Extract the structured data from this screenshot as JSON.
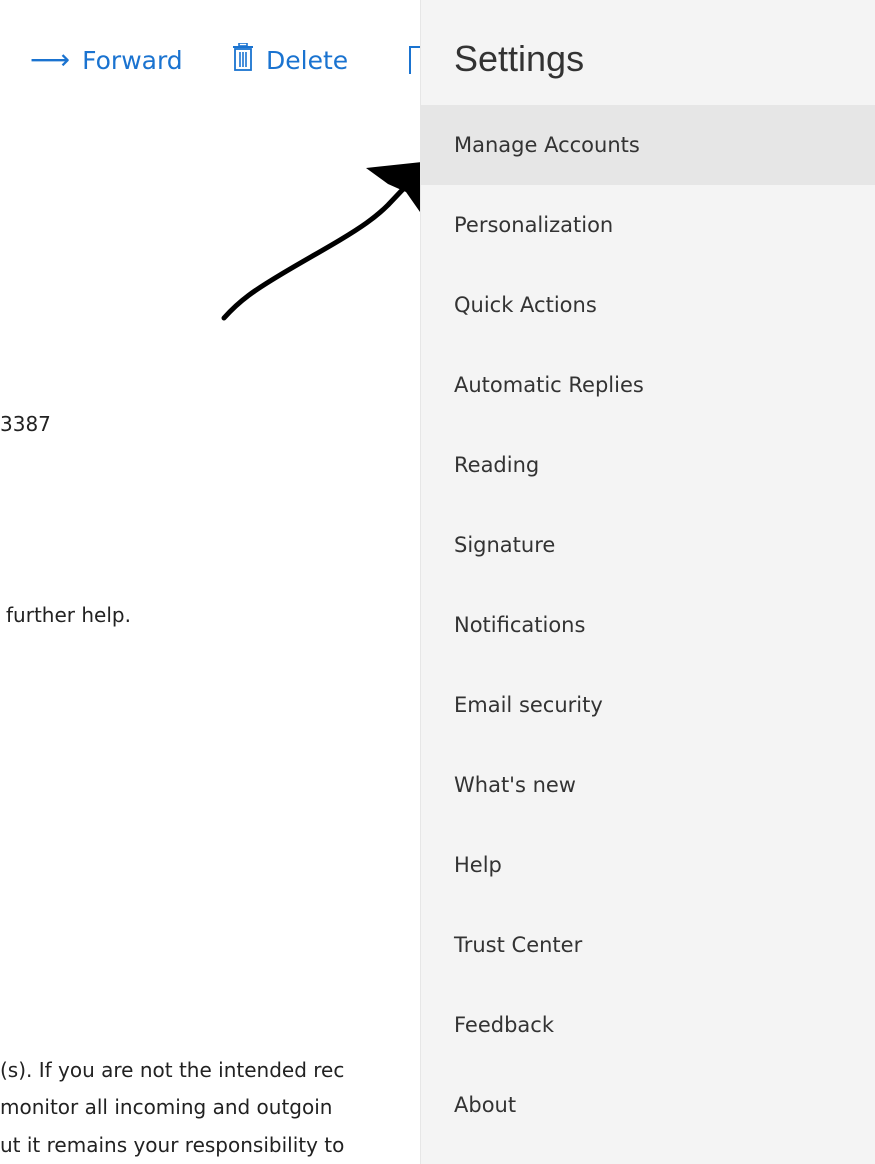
{
  "toolbar": {
    "forward_label": "Forward",
    "delete_label": "Delete"
  },
  "email_body": {
    "line_number": "3387",
    "line_help": "further help.",
    "disclaimer_1": "(s). If you are not the intended rec",
    "disclaimer_2": "monitor all incoming and outgoin",
    "disclaimer_3": "ut it remains your responsibility to"
  },
  "settings": {
    "title": "Settings",
    "items": [
      {
        "label": "Manage Accounts",
        "selected": true
      },
      {
        "label": "Personalization"
      },
      {
        "label": "Quick Actions"
      },
      {
        "label": "Automatic Replies"
      },
      {
        "label": "Reading"
      },
      {
        "label": "Signature"
      },
      {
        "label": "Notifications"
      },
      {
        "label": "Email security"
      },
      {
        "label": "What's new"
      },
      {
        "label": "Help"
      },
      {
        "label": "Trust Center"
      },
      {
        "label": "Feedback"
      },
      {
        "label": "About"
      }
    ]
  },
  "colors": {
    "accent": "#1a73d0",
    "flyout_bg": "#f4f4f4",
    "selected_bg": "#e6e6e6"
  },
  "icons": [
    "arrow-right-icon",
    "trash-icon"
  ]
}
